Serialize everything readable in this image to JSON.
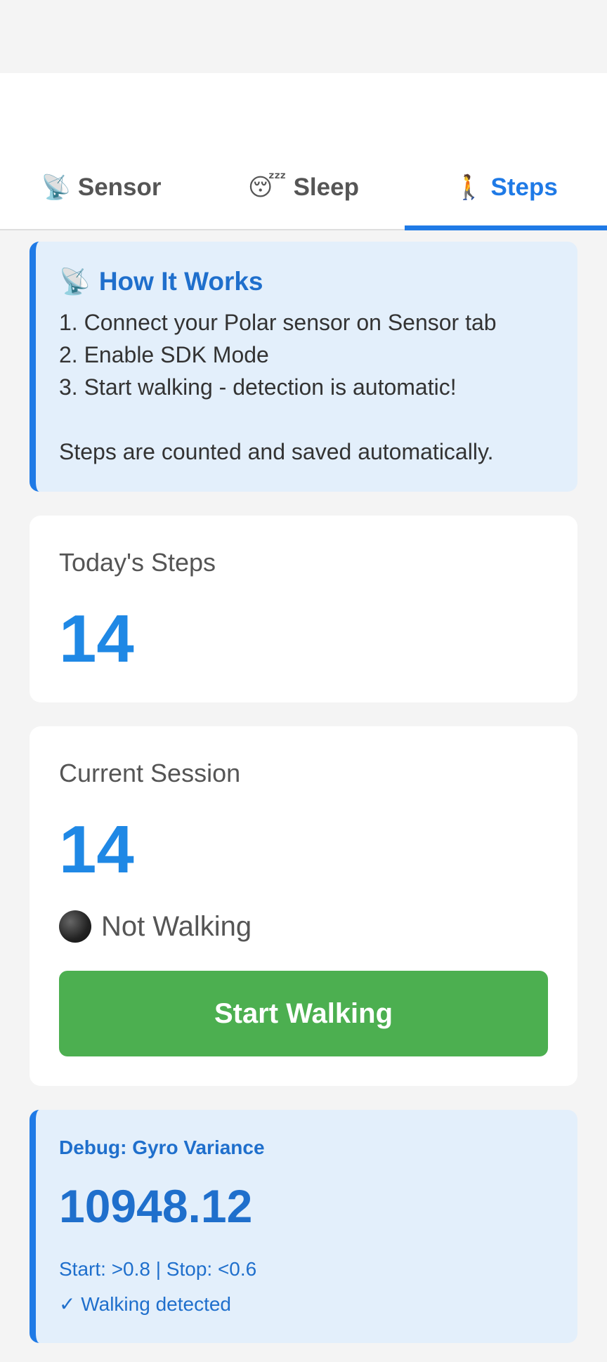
{
  "tabs": [
    {
      "icon": "📡",
      "label": "Sensor",
      "active": false
    },
    {
      "icon": "😴",
      "label": "Sleep",
      "active": false
    },
    {
      "icon": "🚶",
      "label": "Steps",
      "active": true
    }
  ],
  "how_it_works": {
    "icon": "📡",
    "title": "How It Works",
    "lines": [
      "1. Connect your Polar sensor on Sensor tab",
      "2. Enable SDK Mode",
      "3. Start walking - detection is automatic!"
    ],
    "note": "Steps are counted and saved automatically."
  },
  "today": {
    "label": "Today's Steps",
    "value": "14"
  },
  "session": {
    "label": "Current Session",
    "value": "14",
    "status_icon": "⚫",
    "status": "Not Walking",
    "button_label": "Start Walking"
  },
  "debug": {
    "title": "Debug: Gyro Variance",
    "value": "10948.12",
    "thresholds": "Start: >0.8 | Stop: <0.6",
    "detected": "✓ Walking detected"
  },
  "colors": {
    "accent": "#1f7ae6",
    "button_green": "#4caf50",
    "info_bg": "#e3effb"
  }
}
